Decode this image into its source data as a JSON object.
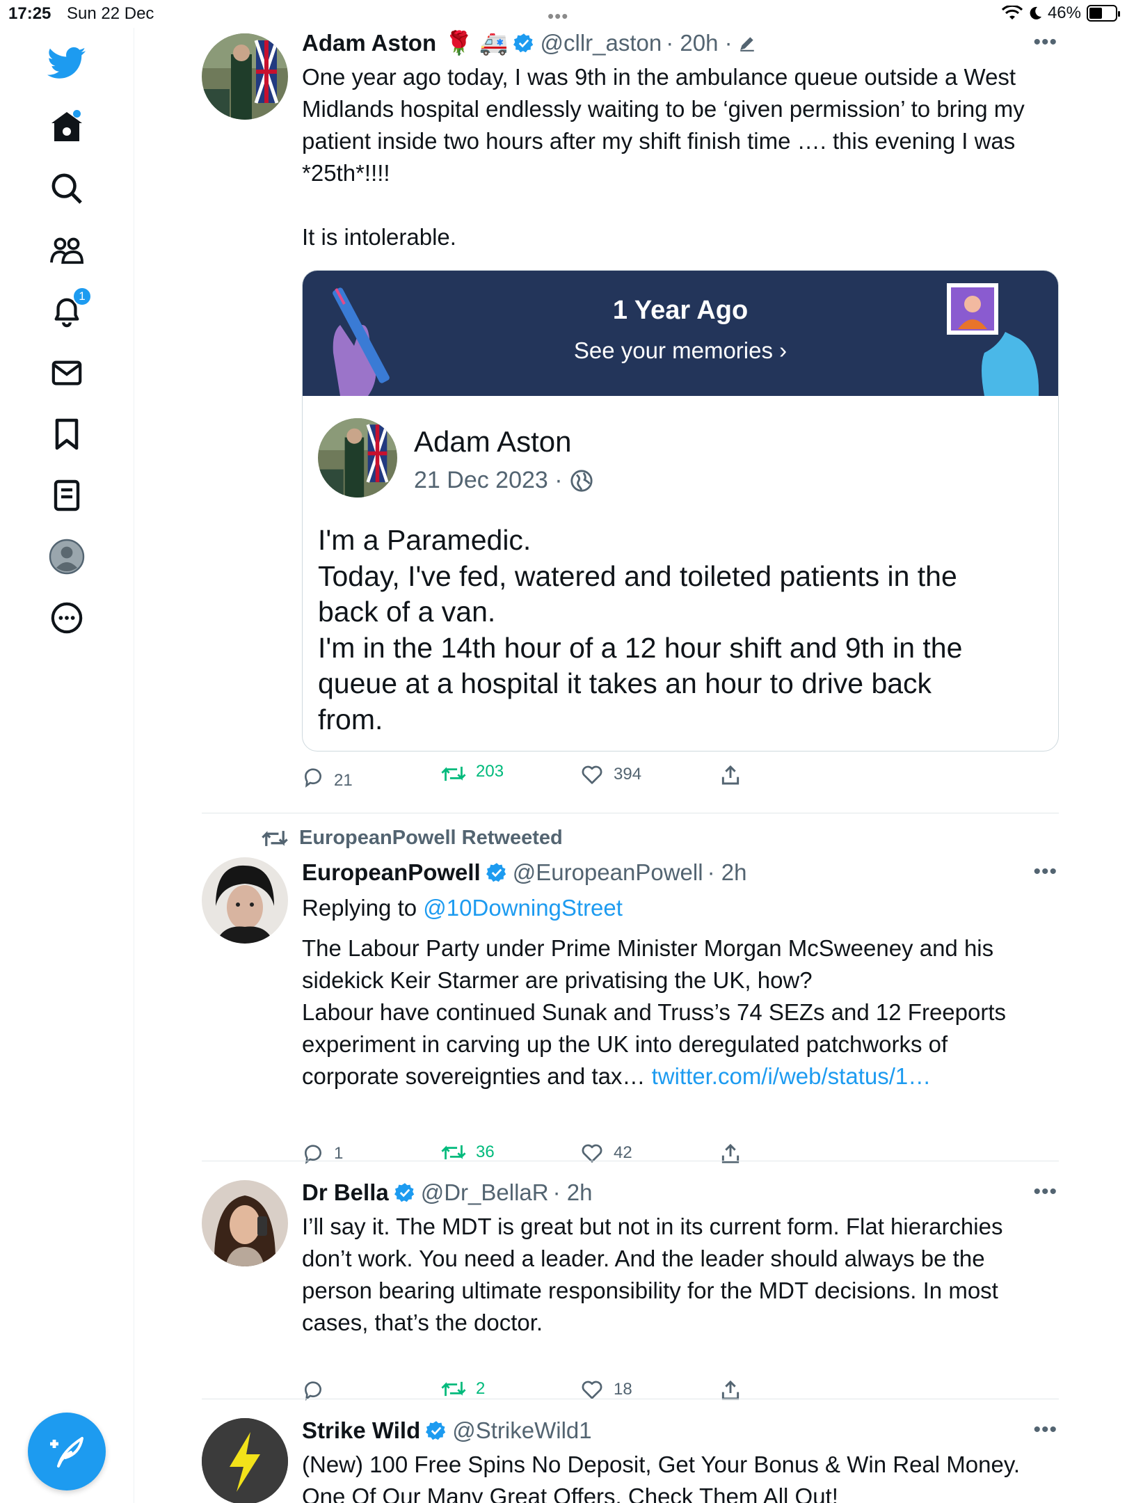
{
  "status_bar": {
    "time": "17:25",
    "date": "Sun 22 Dec",
    "battery": "46%",
    "battery_level": 0.46
  },
  "sidebar": {
    "notifications_badge": "1"
  },
  "tweets": [
    {
      "name": "Adam Aston",
      "emojis": "🌹 🚑",
      "handle": "@cllr_aston",
      "time": "· 20h ·",
      "text_lines": [
        "One year ago today, I was 9th in the ambulance queue outside a West",
        "Midlands hospital endlessly waiting to be ‘given permission’ to bring my",
        "patient inside two hours after my shift finish time …. this evening I was",
        "*25th*!!!!",
        "",
        "It is intolerable."
      ],
      "card": {
        "banner_title": "1 Year Ago",
        "banner_sub": "See your memories",
        "name": "Adam Aston",
        "date": "21 Dec 2023 ·",
        "text_lines": [
          "I'm a Paramedic.",
          "Today, I've fed, watered and toileted patients in the",
          "back of a van.",
          "I'm in the 14th hour of a 12 hour shift and 9th in the",
          "queue at a hospital it takes an hour to drive back",
          "from."
        ]
      },
      "replies": "21",
      "retweets": "203",
      "likes": "394"
    },
    {
      "retweeted_by": "EuropeanPowell Retweeted",
      "name": "EuropeanPowell",
      "handle": "@EuropeanPowell",
      "time": "· 2h",
      "replying_label": "Replying to",
      "replying_to": "@10DowningStreet",
      "text_lines": [
        "The Labour Party under Prime Minister Morgan McSweeney and his",
        "sidekick Keir Starmer are privatising the UK, how?",
        "Labour have continued Sunak and Truss’s 74 SEZs and 12 Freeports",
        "experiment in carving up the UK into deregulated patchworks of"
      ],
      "last_line": "corporate sovereignties and tax…",
      "link": "twitter.com/i/web/status/1…",
      "replies": "1",
      "retweets": "36",
      "likes": "42"
    },
    {
      "name": "Dr Bella",
      "handle": "@Dr_BellaR",
      "time": "· 2h",
      "text_lines": [
        "I’ll say it. The MDT is great but not in its current form. Flat hierarchies",
        "don’t work. You need a leader. And the leader should always be the",
        "person bearing ultimate responsibility for the MDT decisions. In most",
        "cases, that’s the doctor."
      ],
      "replies": "",
      "retweets": "2",
      "likes": "18"
    },
    {
      "name": "Strike Wild",
      "handle": "@StrikeWild1",
      "text_lines": [
        "(New) 100 Free Spins No Deposit, Get Your Bonus & Win Real Money.",
        "One Of Our Many Great Offers. Check Them All Out!"
      ]
    }
  ]
}
